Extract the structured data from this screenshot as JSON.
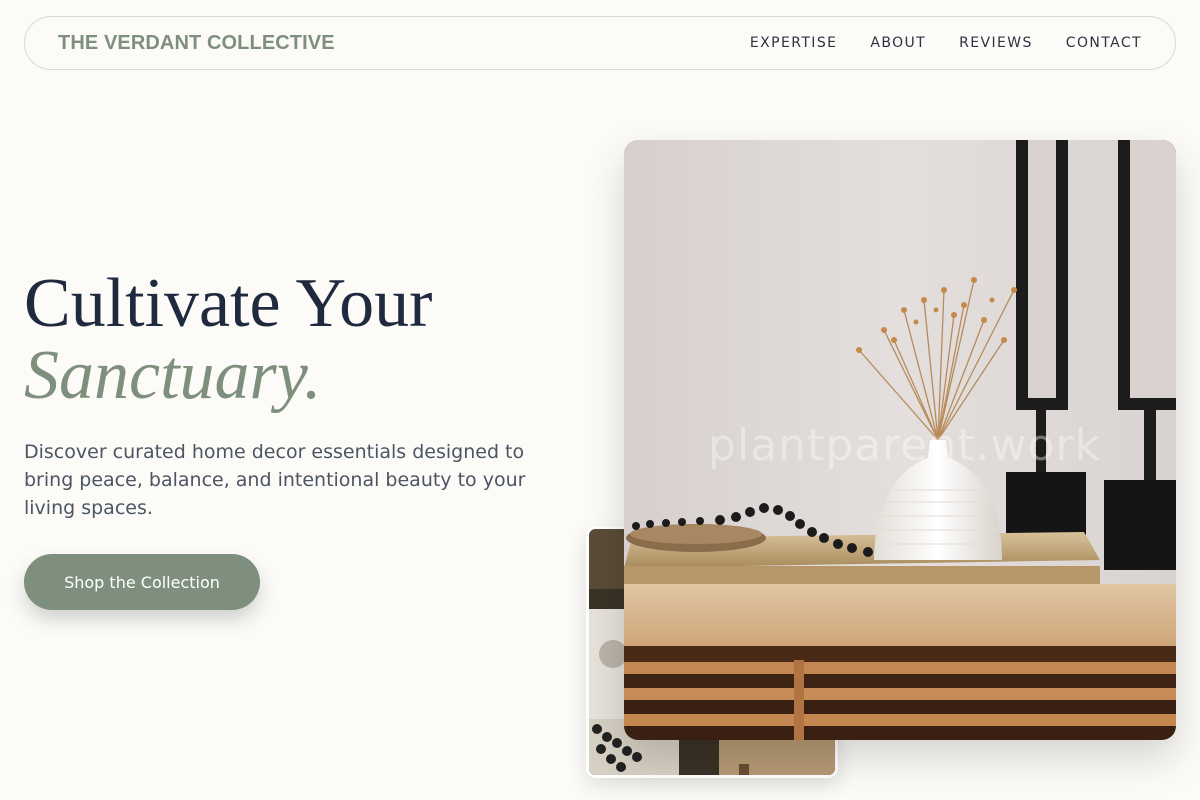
{
  "header": {
    "brand": "THE VERDANT COLLECTIVE",
    "nav": [
      "EXPERTISE",
      "ABOUT",
      "REVIEWS",
      "CONTACT"
    ]
  },
  "hero": {
    "title_line1": "Cultivate Your",
    "title_line2": "Sanctuary.",
    "description": "Discover curated home decor essentials designed to bring peace, balance, and intentional beauty to your living spaces.",
    "cta_label": "Shop the Collection"
  },
  "images": {
    "main_watermark": "plantparent.work"
  },
  "colors": {
    "accent": "#7f8f7d",
    "heading": "#1f2a3f",
    "body_text": "#4b5563",
    "background": "#fcfbf8"
  }
}
